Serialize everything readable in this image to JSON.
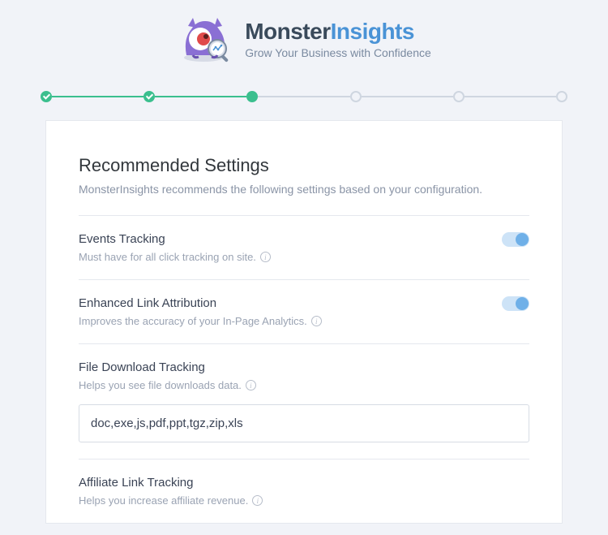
{
  "brand": {
    "name_part1": "Monster",
    "name_part2": "Insights",
    "tagline": "Grow Your Business with Confidence"
  },
  "stepper": {
    "total": 6,
    "completed": 2,
    "current": 3
  },
  "page": {
    "title": "Recommended Settings",
    "subtitle": "MonsterInsights recommends the following settings based on your configuration."
  },
  "settings": {
    "events_tracking": {
      "title": "Events Tracking",
      "desc": "Must have for all click tracking on site.",
      "enabled": true
    },
    "enhanced_link": {
      "title": "Enhanced Link Attribution",
      "desc": "Improves the accuracy of your In-Page Analytics.",
      "enabled": true
    },
    "file_download": {
      "title": "File Download Tracking",
      "desc": "Helps you see file downloads data.",
      "value": "doc,exe,js,pdf,ppt,tgz,zip,xls"
    },
    "affiliate": {
      "title": "Affiliate Link Tracking",
      "desc": "Helps you increase affiliate revenue."
    }
  },
  "info_glyph": "i"
}
